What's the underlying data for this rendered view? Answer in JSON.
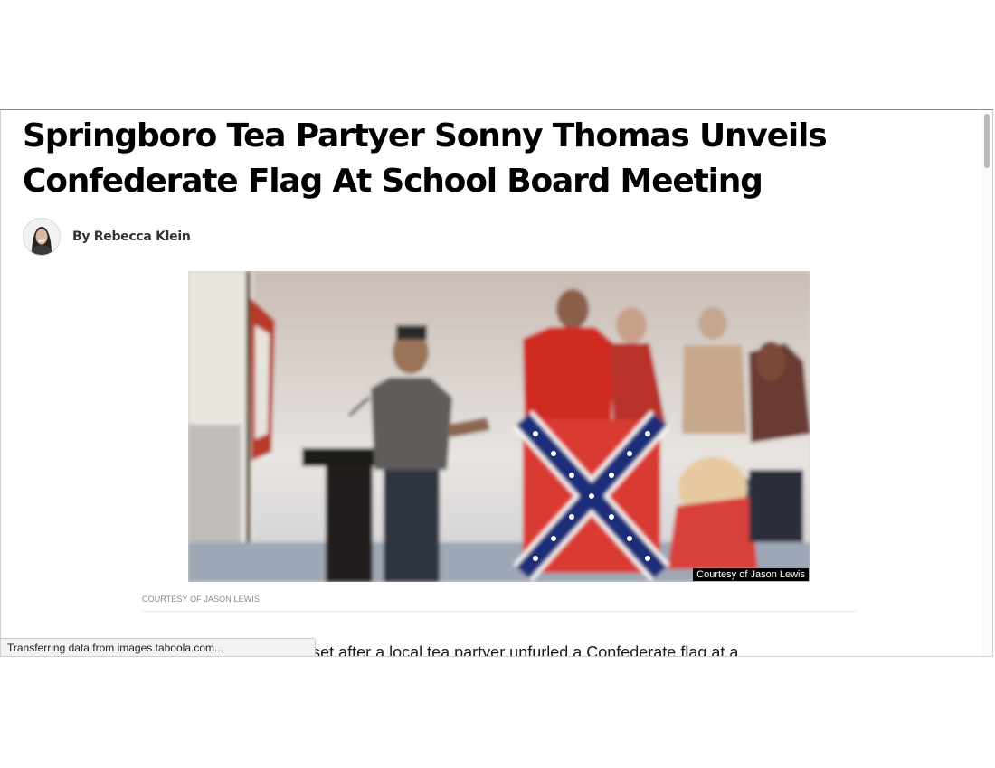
{
  "article": {
    "headline": "Springboro Tea Partyer Sonny Thomas Unveils Confederate Flag At School Board Meeting",
    "byline": "By Rebecca Klein",
    "photo_overlay_credit": "Courtesy of Jason Lewis",
    "photo_caption_credit": "COURTESY OF JASON LEWIS",
    "body_first_line_partial": "unity members are upset after a local tea partyer unfurled a Confederate flag at a"
  },
  "browser": {
    "status_text": "Transferring data from images.taboola.com..."
  },
  "icons": {
    "avatar": "author-avatar",
    "scrollbar": "vertical-scrollbar"
  },
  "colors": {
    "headline": "#000000",
    "accent_border": "#e06a4a",
    "caption": "#8a8a8a"
  }
}
